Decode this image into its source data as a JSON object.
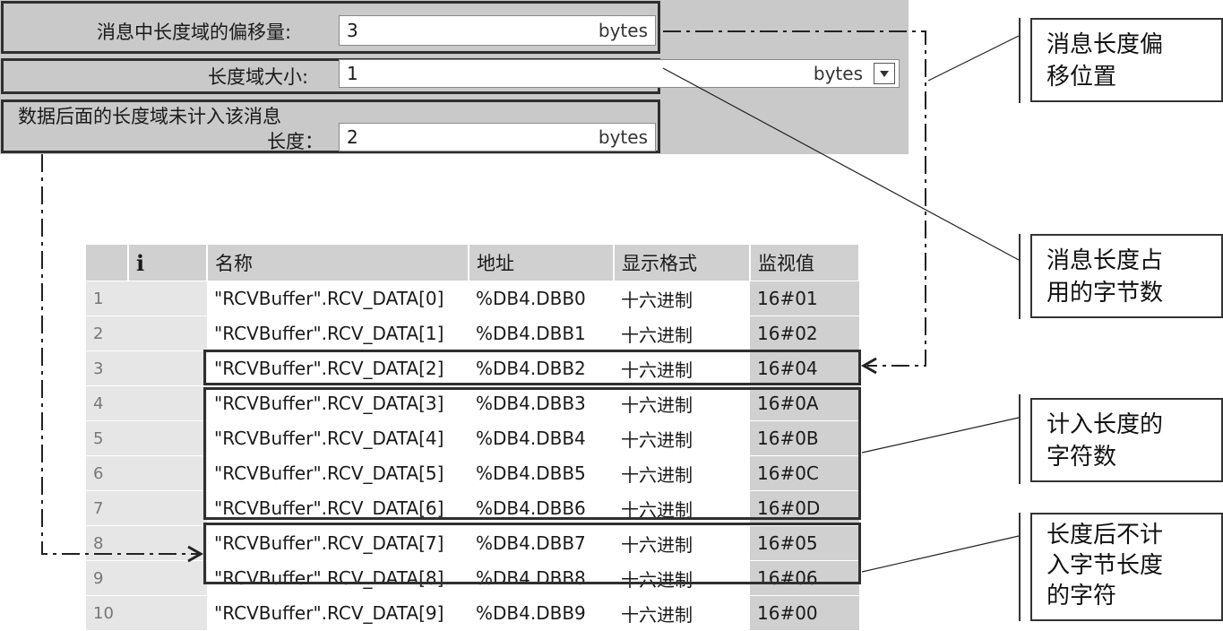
{
  "config": {
    "offset_label": "消息中长度域的偏移量:",
    "offset_value": "3",
    "size_label": "长度域大小:",
    "size_value": "1",
    "excluded_label_line1": "数据后面的长度域未计入该消息",
    "excluded_label_line2": "长度：",
    "excluded_value": "2",
    "unit": "bytes"
  },
  "table": {
    "headers": {
      "info_icon": "i",
      "name": "名称",
      "address": "地址",
      "format": "显示格式",
      "monitor": "监视值"
    },
    "rows": [
      {
        "idx": "1",
        "name": "\"RCVBuffer\".RCV_DATA[0]",
        "address": "%DB4.DBB0",
        "format": "十六进制",
        "value": "16#01"
      },
      {
        "idx": "2",
        "name": "\"RCVBuffer\".RCV_DATA[1]",
        "address": "%DB4.DBB1",
        "format": "十六进制",
        "value": "16#02"
      },
      {
        "idx": "3",
        "name": "\"RCVBuffer\".RCV_DATA[2]",
        "address": "%DB4.DBB2",
        "format": "十六进制",
        "value": "16#04"
      },
      {
        "idx": "4",
        "name": "\"RCVBuffer\".RCV_DATA[3]",
        "address": "%DB4.DBB3",
        "format": "十六进制",
        "value": "16#0A"
      },
      {
        "idx": "5",
        "name": "\"RCVBuffer\".RCV_DATA[4]",
        "address": "%DB4.DBB4",
        "format": "十六进制",
        "value": "16#0B"
      },
      {
        "idx": "6",
        "name": "\"RCVBuffer\".RCV_DATA[5]",
        "address": "%DB4.DBB5",
        "format": "十六进制",
        "value": "16#0C"
      },
      {
        "idx": "7",
        "name": "\"RCVBuffer\".RCV_DATA[6]",
        "address": "%DB4.DBB6",
        "format": "十六进制",
        "value": "16#0D"
      },
      {
        "idx": "8",
        "name": "\"RCVBuffer\".RCV_DATA[7]",
        "address": "%DB4.DBB7",
        "format": "十六进制",
        "value": "16#05"
      },
      {
        "idx": "9",
        "name": "\"RCVBuffer\".RCV_DATA[8]",
        "address": "%DB4.DBB8",
        "format": "十六进制",
        "value": "16#06"
      },
      {
        "idx": "10",
        "name": "\"RCVBuffer\".RCV_DATA[9]",
        "address": "%DB4.DBB9",
        "format": "十六进制",
        "value": "16#00"
      }
    ]
  },
  "callouts": {
    "offset_position": "消息长度偏\n移位置",
    "length_bytes": "消息长度占\n用的字节数",
    "counted_chars": "计入长度的\n字符数",
    "not_counted_chars": "长度后不计\n入字节长度\n的字符"
  }
}
